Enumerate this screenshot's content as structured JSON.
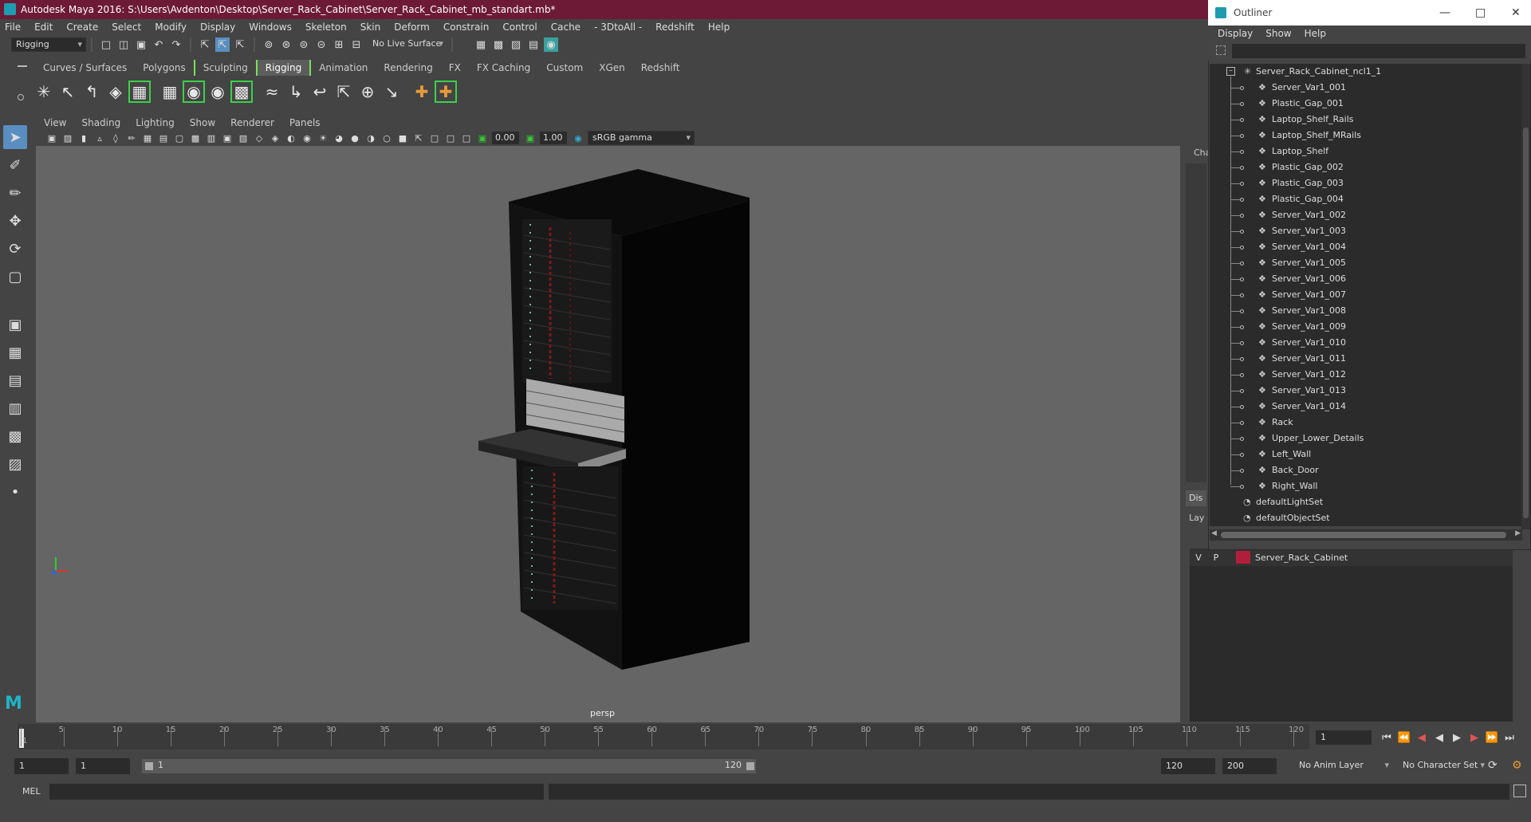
{
  "window": {
    "title": "Autodesk Maya 2016: S:\\Users\\Avdenton\\Desktop\\Server_Rack_Cabinet\\Server_Rack_Cabinet_mb_standart.mb*"
  },
  "menubar": [
    "File",
    "Edit",
    "Create",
    "Select",
    "Modify",
    "Display",
    "Windows",
    "Skeleton",
    "Skin",
    "Deform",
    "Constrain",
    "Control",
    "Cache",
    "- 3DtoAll -",
    "Redshift",
    "Help"
  ],
  "statusline": {
    "mode": "Rigging",
    "live_surface": "No Live Surface"
  },
  "shelf_tabs": [
    "Curves / Surfaces",
    "Polygons",
    "Sculpting",
    "Rigging",
    "Animation",
    "Rendering",
    "FX",
    "FX Caching",
    "Custom",
    "XGen",
    "Redshift"
  ],
  "shelf_active": "Rigging",
  "viewport": {
    "menu": [
      "View",
      "Shading",
      "Lighting",
      "Show",
      "Renderer",
      "Panels"
    ],
    "exposure": "0.00",
    "gamma": "1.00",
    "color_space": "sRGB gamma",
    "camera_label": "persp"
  },
  "outliner": {
    "title": "Outliner",
    "menu": [
      "Display",
      "Show",
      "Help"
    ],
    "root": "Server_Rack_Cabinet_ncl1_1",
    "children": [
      "Server_Var1_001",
      "Plastic_Gap_001",
      "Laptop_Shelf_Rails",
      "Laptop_Shelf_MRails",
      "Laptop_Shelf",
      "Plastic_Gap_002",
      "Plastic_Gap_003",
      "Plastic_Gap_004",
      "Server_Var1_002",
      "Server_Var1_003",
      "Server_Var1_004",
      "Server_Var1_005",
      "Server_Var1_006",
      "Server_Var1_007",
      "Server_Var1_008",
      "Server_Var1_009",
      "Server_Var1_010",
      "Server_Var1_011",
      "Server_Var1_012",
      "Server_Var1_013",
      "Server_Var1_014",
      "Rack",
      "Upper_Lower_Details",
      "Left_Wall",
      "Back_Door",
      "Right_Wall"
    ],
    "sets": [
      "defaultLightSet",
      "defaultObjectSet"
    ]
  },
  "side_panel": {
    "channel_tab": "Cha",
    "display_tab": "Dis",
    "layers_tab": "Lay"
  },
  "layer": {
    "v": "V",
    "p": "P",
    "name": "Server_Rack_Cabinet",
    "color": "#b01e3c"
  },
  "timeline": {
    "ticks": [
      "1",
      "5",
      "10",
      "15",
      "20",
      "25",
      "30",
      "35",
      "40",
      "45",
      "50",
      "55",
      "60",
      "65",
      "70",
      "75",
      "80",
      "85",
      "90",
      "95",
      "100",
      "105",
      "110",
      "115",
      "120"
    ],
    "current_frame": "1"
  },
  "range": {
    "start": "1",
    "playback_start": "1",
    "slider_start": "1",
    "slider_end": "120",
    "playback_end": "120",
    "end": "200",
    "anim_layer": "No Anim Layer",
    "character_set": "No Character Set"
  },
  "command_line": {
    "label": "MEL"
  }
}
